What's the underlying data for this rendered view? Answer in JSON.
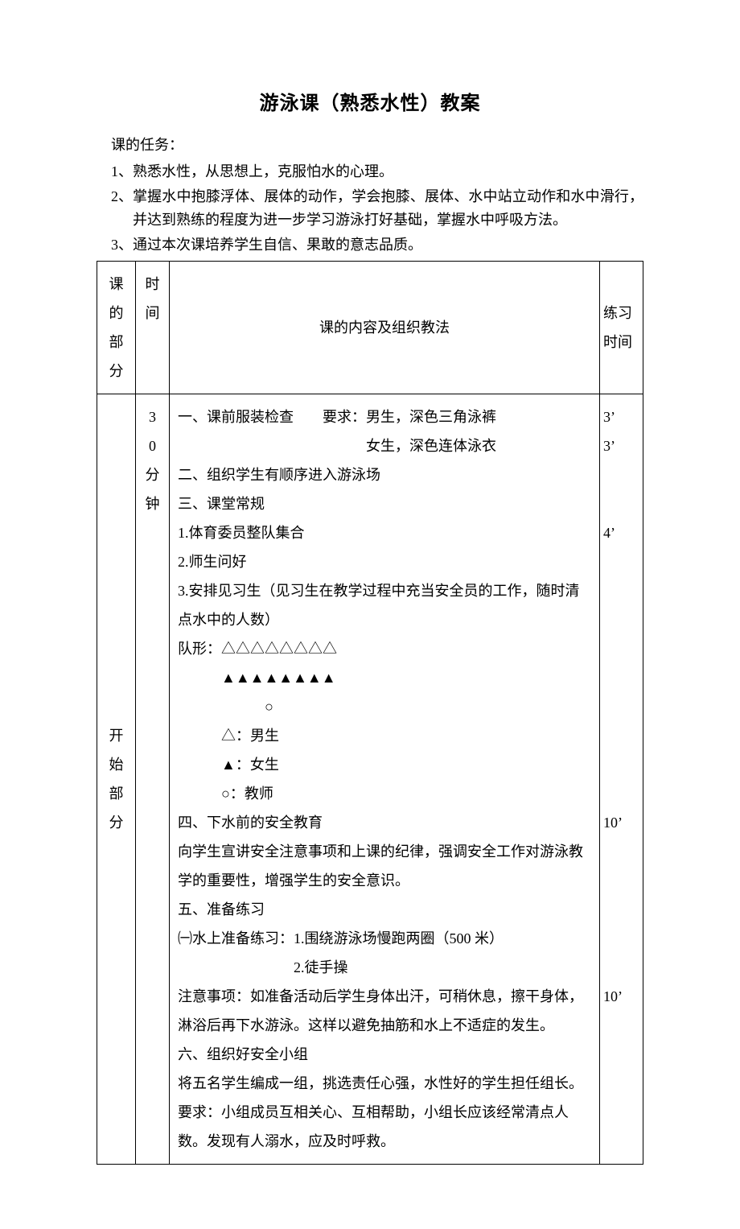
{
  "title": "游泳课（熟悉水性）教案",
  "tasks_label": "课的任务：",
  "tasks": [
    {
      "num": "1、",
      "text": "熟悉水性，从思想上，克服怕水的心理。"
    },
    {
      "num": "2、",
      "text": "掌握水中抱膝浮体、展体的动作，学会抱膝、展体、水中站立动作和水中滑行，并达到熟练的程度为进一步学习游泳打好基础，掌握水中呼吸方法。"
    },
    {
      "num": "3、",
      "text": "通过本次课培养学生自信、果敢的意志品质。"
    }
  ],
  "table": {
    "headers": {
      "part": "课的部分",
      "time": "时间",
      "content": "课的内容及组织教法",
      "practice": "练习时间"
    },
    "row": {
      "part": "开始部分",
      "time": "30分钟",
      "content_lines": [
        "一、课前服装检查　　要求：男生，深色三角泳裤",
        "　　　　　　　　　　　　　女生，深色连体泳衣",
        "二、组织学生有顺序进入游泳场",
        "三、课堂常规",
        "1.体育委员整队集合",
        "2.师生问好",
        "3.安排见习生（见习生在教学过程中充当安全员的工作，随时清点水中的人数）",
        "队形：△△△△△△△△",
        "　　　▲▲▲▲▲▲▲▲",
        "　　　　　　○",
        "　　　△：男生",
        "　　　▲：女生",
        "　　　○：教师",
        "四、下水前的安全教育",
        "向学生宣讲安全注意事项和上课的纪律，强调安全工作对游泳教学的重要性，增强学生的安全意识。",
        "五、准备练习",
        "㈠水上准备练习：1.围绕游泳场慢跑两圈（500 米）",
        "　　　　　　　　2.徒手操",
        "注意事项：如准备活动后学生身体出汗，可稍休息，擦干身体，淋浴后再下水游泳。这样以避免抽筋和水上不适症的发生。",
        "六、组织好安全小组",
        "将五名学生编成一组，挑选责任心强，水性好的学生担任组长。",
        "要求：小组成员互相关心、互相帮助，小组长应该经常清点人数。发现有人溺水，应及时呼救。"
      ],
      "practice_items": [
        {
          "val": "3'",
          "gap": 0
        },
        {
          "val": "3'",
          "gap": 0
        },
        {
          "val": "4'",
          "gap": 2
        },
        {
          "val": "10'",
          "gap": 9
        },
        {
          "val": "10'",
          "gap": 5
        }
      ]
    }
  }
}
